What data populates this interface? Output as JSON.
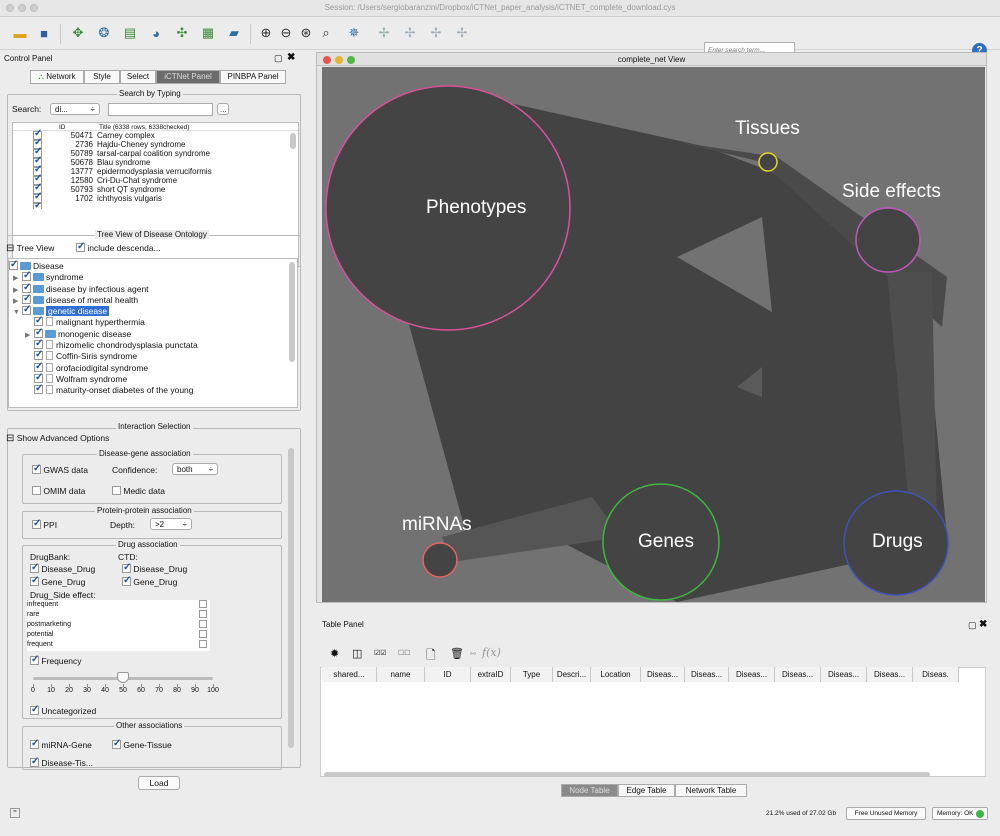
{
  "window": {
    "title": "Session: /Users/sergiobaranzini/Dropbox/iCTNet_paper_analysis/iCTNET_complete_download.cys"
  },
  "toolbar": {
    "search_placeholder": "Enter search term...",
    "help_label": "?"
  },
  "control_panel": {
    "title": "Control Panel",
    "tabs": [
      {
        "label": "Network",
        "selected": false
      },
      {
        "label": "Style",
        "selected": false
      },
      {
        "label": "Select",
        "selected": false
      },
      {
        "label": "iCTNet Panel",
        "selected": true
      },
      {
        "label": "PINBPA Panel",
        "selected": false
      }
    ],
    "search_by_typing": {
      "title": "Search by Typing",
      "search_label": "Search:",
      "search_field": "di...",
      "browse_label": "...",
      "col_id": "ID",
      "col_title": "Title (6338 rows, 6338checked)",
      "rows": [
        {
          "id": "50471",
          "title": "Carney complex"
        },
        {
          "id": "2736",
          "title": "Hajdu-Cheney syndrome"
        },
        {
          "id": "50789",
          "title": "tarsal-carpal coalition syndrome"
        },
        {
          "id": "50678",
          "title": "Blau syndrome"
        },
        {
          "id": "13777",
          "title": "epidermodysplasia verruciformis"
        },
        {
          "id": "12580",
          "title": "Cri-Du-Chat syndrome"
        },
        {
          "id": "50793",
          "title": "short QT syndrome"
        },
        {
          "id": "1702",
          "title": "ichthyosis vulgaris"
        }
      ]
    },
    "tree_view": {
      "title": "Tree View of Disease Ontology",
      "tree_view_label": "Tree View",
      "include_label": "include descenda...",
      "items": [
        {
          "label": "Disease",
          "level": 0,
          "type": "folder",
          "arrow": ""
        },
        {
          "label": "syndrome",
          "level": 1,
          "type": "folder",
          "arrow": "▶"
        },
        {
          "label": "disease by infectious agent",
          "level": 1,
          "type": "folder",
          "arrow": "▶"
        },
        {
          "label": "disease of mental health",
          "level": 1,
          "type": "folder",
          "arrow": "▶"
        },
        {
          "label": "genetic disease",
          "level": 1,
          "type": "folder",
          "arrow": "▼",
          "selected": true
        },
        {
          "label": "malignant hyperthermia",
          "level": 2,
          "type": "doc",
          "arrow": ""
        },
        {
          "label": "monogenic disease",
          "level": 2,
          "type": "folder",
          "arrow": "▶"
        },
        {
          "label": "rhizomelic chondrodysplasia punctata",
          "level": 2,
          "type": "doc",
          "arrow": ""
        },
        {
          "label": "Coffin-Siris syndrome",
          "level": 2,
          "type": "doc",
          "arrow": ""
        },
        {
          "label": "orofaciodigital syndrome",
          "level": 2,
          "type": "doc",
          "arrow": ""
        },
        {
          "label": "Wolfram syndrome",
          "level": 2,
          "type": "doc",
          "arrow": ""
        },
        {
          "label": "maturity-onset diabetes of the young",
          "level": 2,
          "type": "doc",
          "arrow": ""
        }
      ]
    },
    "interaction": {
      "title": "Interaction Selection",
      "show_advanced": "Show Advanced Options",
      "disease_gene": {
        "title": "Disease-gene association",
        "gwas": "GWAS data",
        "confidence_label": "Confidence:",
        "confidence_value": "both",
        "omim": "OMIM data",
        "medic": "Medic data"
      },
      "ppi": {
        "title": "Protein-protein association",
        "ppi_label": "PPI",
        "depth_label": "Depth:",
        "depth_value": ">2"
      },
      "drug": {
        "title": "Drug association",
        "drugbank": "DrugBank:",
        "ctd": "CTD:",
        "db_disease_drug": "Disease_Drug",
        "db_gene_drug": "Gene_Drug",
        "ctd_disease_drug": "Disease_Drug",
        "ctd_gene_drug": "Gene_Drug",
        "side_effect_label": "Drug_Side effect:",
        "side_effects": [
          "infrequent",
          "rare",
          "postmarketing",
          "potential",
          "frequent"
        ],
        "frequency_label": "Frequency",
        "slider_ticks": [
          "0",
          "10",
          "20",
          "30",
          "40",
          "50",
          "60",
          "70",
          "80",
          "90",
          "100"
        ],
        "slider_value": 50,
        "uncategorized": "Uncategorized"
      },
      "other": {
        "title": "Other associations",
        "mirna_gene": "miRNA-Gene",
        "gene_tissue": "Gene-Tissue",
        "disease_tis": "Disease-Tis..."
      }
    },
    "load_label": "Load"
  },
  "network_view": {
    "title": "complete_net View",
    "nodes": [
      {
        "label": "Phenotypes",
        "color": "#d9519b"
      },
      {
        "label": "Tissues",
        "color": "#e0d829"
      },
      {
        "label": "Side effects",
        "color": "#c05ab8"
      },
      {
        "label": "miRNAs",
        "color": "#e66464"
      },
      {
        "label": "Genes",
        "color": "#3fb73f"
      },
      {
        "label": "Drugs",
        "color": "#3f52b8"
      }
    ]
  },
  "table_panel": {
    "title": "Table Panel",
    "fx_label": "f(x)",
    "columns": [
      "shared...",
      "name",
      "ID",
      "extraID",
      "Type",
      "Descri...",
      "Location",
      "Diseas...",
      "Diseas...",
      "Diseas...",
      "Diseas...",
      "Diseas...",
      "Diseas...",
      "Diseas."
    ],
    "tabs": [
      {
        "label": "Node Table",
        "selected": true
      },
      {
        "label": "Edge Table",
        "selected": false
      },
      {
        "label": "Network Table",
        "selected": false
      }
    ]
  },
  "status": {
    "memory_text": "21.2% used of 27.02 Gb",
    "free_memory_label": "Free Unused Memory",
    "memory_ok_label": "Memory: OK"
  }
}
